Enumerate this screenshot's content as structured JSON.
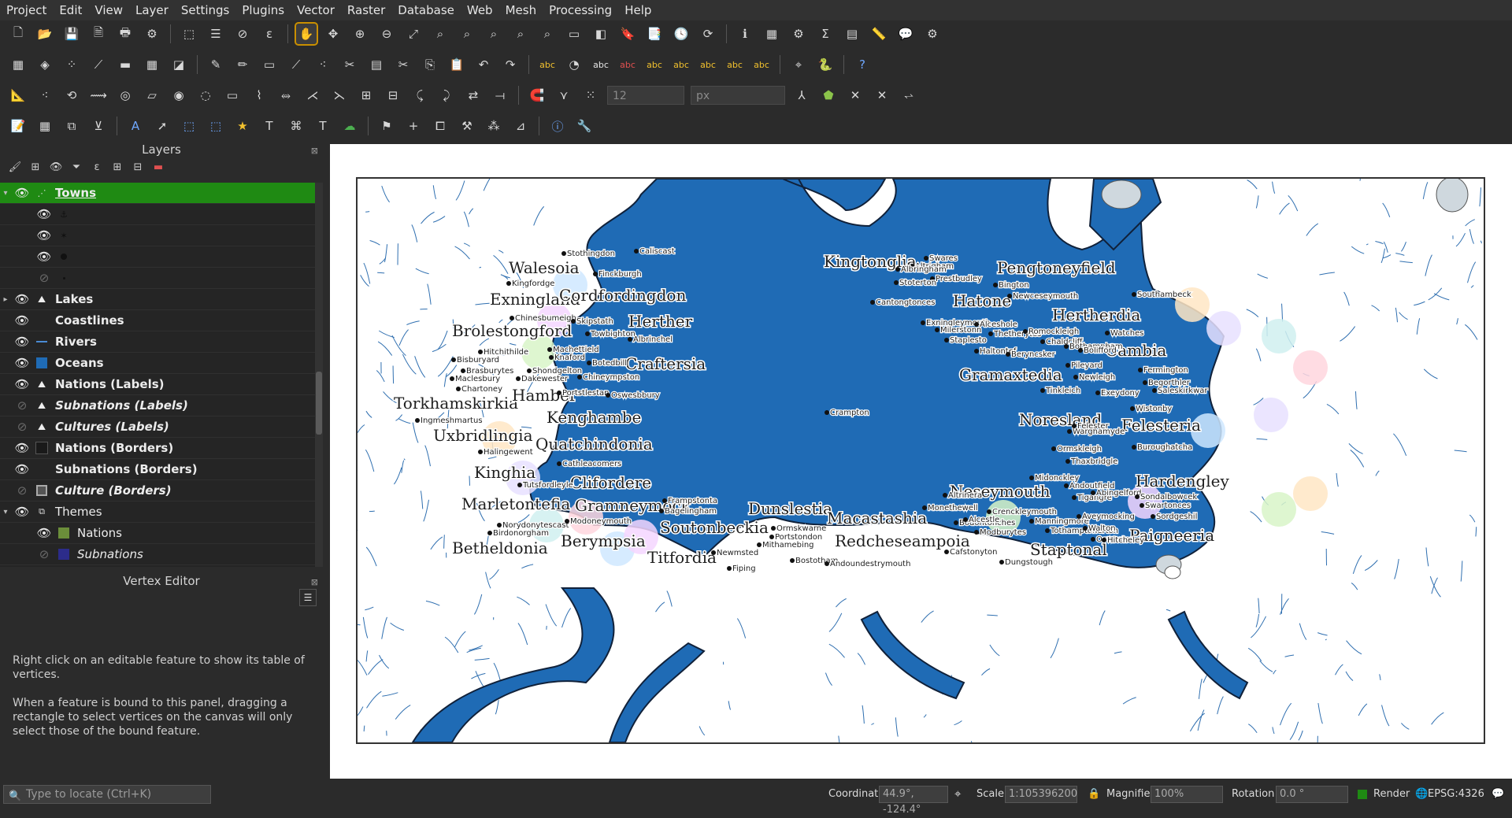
{
  "menubar": {
    "items": [
      "Project",
      "Edit",
      "View",
      "Layer",
      "Settings",
      "Plugins",
      "Vector",
      "Raster",
      "Database",
      "Web",
      "Mesh",
      "Processing",
      "Help"
    ]
  },
  "toolbar": {
    "snap_tolerance_value": "12",
    "snap_units": "px"
  },
  "layers_panel": {
    "title": "Layers",
    "layers": [
      {
        "name": "Towns",
        "visible": true,
        "expanded": true,
        "selected": true,
        "style": "bold-underline",
        "icon": "point-layer-icon"
      },
      {
        "name": "⚓",
        "visible": true,
        "child": true,
        "icon": "anchor-symbol-icon"
      },
      {
        "name": "✶",
        "visible": true,
        "child": true,
        "icon": "star-symbol-icon"
      },
      {
        "name": "●",
        "visible": true,
        "child": true,
        "icon": "dot-symbol-icon"
      },
      {
        "name": "·",
        "visible": false,
        "child": true,
        "icon": "small-dot-symbol-icon"
      },
      {
        "name": "Lakes",
        "visible": true,
        "collapsed": true,
        "icon": "polygon-layer-icon"
      },
      {
        "name": "Coastlines",
        "visible": true,
        "icon": "none"
      },
      {
        "name": "Rivers",
        "visible": true,
        "icon": "line-layer-icon"
      },
      {
        "name": "Oceans",
        "visible": true,
        "icon": "fill-blue-icon"
      },
      {
        "name": "Nations (Labels)",
        "visible": true,
        "icon": "polygon-layer-icon"
      },
      {
        "name": "Subnations (Labels)",
        "visible": false,
        "italic": true,
        "icon": "polygon-layer-icon"
      },
      {
        "name": "Cultures (Labels)",
        "visible": false,
        "italic": true,
        "icon": "polygon-layer-icon"
      },
      {
        "name": "Nations (Borders)",
        "visible": true,
        "icon": "fill-dark-icon"
      },
      {
        "name": "Subnations (Borders)",
        "visible": true,
        "icon": "none"
      },
      {
        "name": "Culture (Borders)",
        "visible": false,
        "italic": true,
        "icon": "fill-outline-icon"
      },
      {
        "name": "Themes",
        "visible": true,
        "expanded": true,
        "normal": true,
        "icon": "group-icon"
      },
      {
        "name": "Nations",
        "visible": true,
        "child": true,
        "icon": "fill-green-icon"
      },
      {
        "name": "Subnations",
        "visible": false,
        "child": true,
        "italic": true,
        "icon": "fill-navy-icon"
      }
    ]
  },
  "vertex_editor": {
    "title": "Vertex Editor",
    "line1": "Right click on an editable feature to show its table of vertices.",
    "line2": "When a feature is bound to this panel, dragging a rectangle to select vertices on the canvas will only select those of the bound feature."
  },
  "map": {
    "ocean_color": "#1f6bb5",
    "nation_labels": [
      "Walesoia",
      "Exningland",
      "Cordfordingdon",
      "Brolestongford",
      "Herther",
      "Craftersia",
      "Torkhamskirkia",
      "Hamber",
      "Kenghambe",
      "Uxbridlingia",
      "Quatchindonia",
      "Kinghia",
      "Clifordere",
      "Marletontefia",
      "Gramneymock",
      "Soutonbeckia",
      "Betheldonia",
      "Berympsia",
      "Titfordia",
      "Dunslestia",
      "Macastashia",
      "Redcheseampoia",
      "Kingtonglia",
      "Pengtoneyfield",
      "Hatone",
      "Hertherdia",
      "Cambia",
      "Gramaxtedia",
      "Noresland",
      "Felesteria",
      "Neseymouth",
      "Hardengley",
      "Staptonal",
      "Paigneeria"
    ],
    "town_labels": [
      "Stothingdon",
      "Caliscast",
      "Kingfordge",
      "Finckburgh",
      "Chinesbumeigh",
      "Skipstath",
      "Towbighton",
      "Albrinchel",
      "Hitchithilde",
      "Machettield",
      "Bisburyard",
      "Knaford",
      "Botedbill",
      "Brasburytes",
      "Shondgelton",
      "Maclesbury",
      "Dakewester",
      "Chineympston",
      "Chartoney",
      "Portstlestan",
      "Oswesbbury",
      "Ingmeshmartus",
      "Halingewent",
      "Cathleacomers",
      "Tutsfordleyle",
      "Norydonytescast",
      "Birdonorgham",
      "Modoneymouth",
      "Frampstonta",
      "Bagelingham",
      "Newmsted",
      "Fiping",
      "Ormskwarne",
      "Portstondon",
      "Mithamebing",
      "Bostotham",
      "Andoundestrymouth",
      "Altrinera",
      "Monethewell",
      "Bodontonches",
      "Alcestle",
      "Cafstonyton",
      "Crenckleymouth",
      "Manningmore",
      "Modburytes",
      "Dungstough",
      "Tothamptonerton",
      "Swares",
      "Altrigham",
      "Albringham",
      "Prestbudley",
      "Bington",
      "Stoterton",
      "Cantongtonces",
      "Newceseymouth",
      "Exningleymouth",
      "Milerstonn",
      "Alceshole",
      "Staplesto",
      "Thetherytes",
      "Haltontef",
      "Beryncsker",
      "Romockleigh",
      "Chaldcliff",
      "Bothampham",
      "Bolifford",
      "Watches",
      "Southambeck",
      "Pileyard",
      "Newleigh",
      "Tinkleich",
      "Exeydony",
      "Fermington",
      "Begorthler",
      "Saleskirkwar",
      "Wistonby",
      "Warghamyde",
      "Felester",
      "Ormskleigh",
      "Thaxbridgle",
      "Buroughatcha",
      "Midonckley",
      "Andoutfield",
      "Tigangre",
      "Abingelford",
      "Sondalbowcek",
      "Swartonces",
      "Sordgeshil",
      "Aveymocking",
      "Walton",
      "Oswester",
      "Hitcheley",
      "Crampton"
    ]
  },
  "statusbar": {
    "locator_placeholder": "Type to locate (Ctrl+K)",
    "coordinate_label": "Coordinate",
    "coordinate_value": "44.9°, -124.4°",
    "scale_label": "Scale",
    "scale_value": "1:105396200",
    "magnifier_label": "Magnifier",
    "magnifier_value": "100%",
    "rotation_label": "Rotation",
    "rotation_value": "0.0 °",
    "render_label": "Render",
    "crs_value": "EPSG:4326"
  }
}
